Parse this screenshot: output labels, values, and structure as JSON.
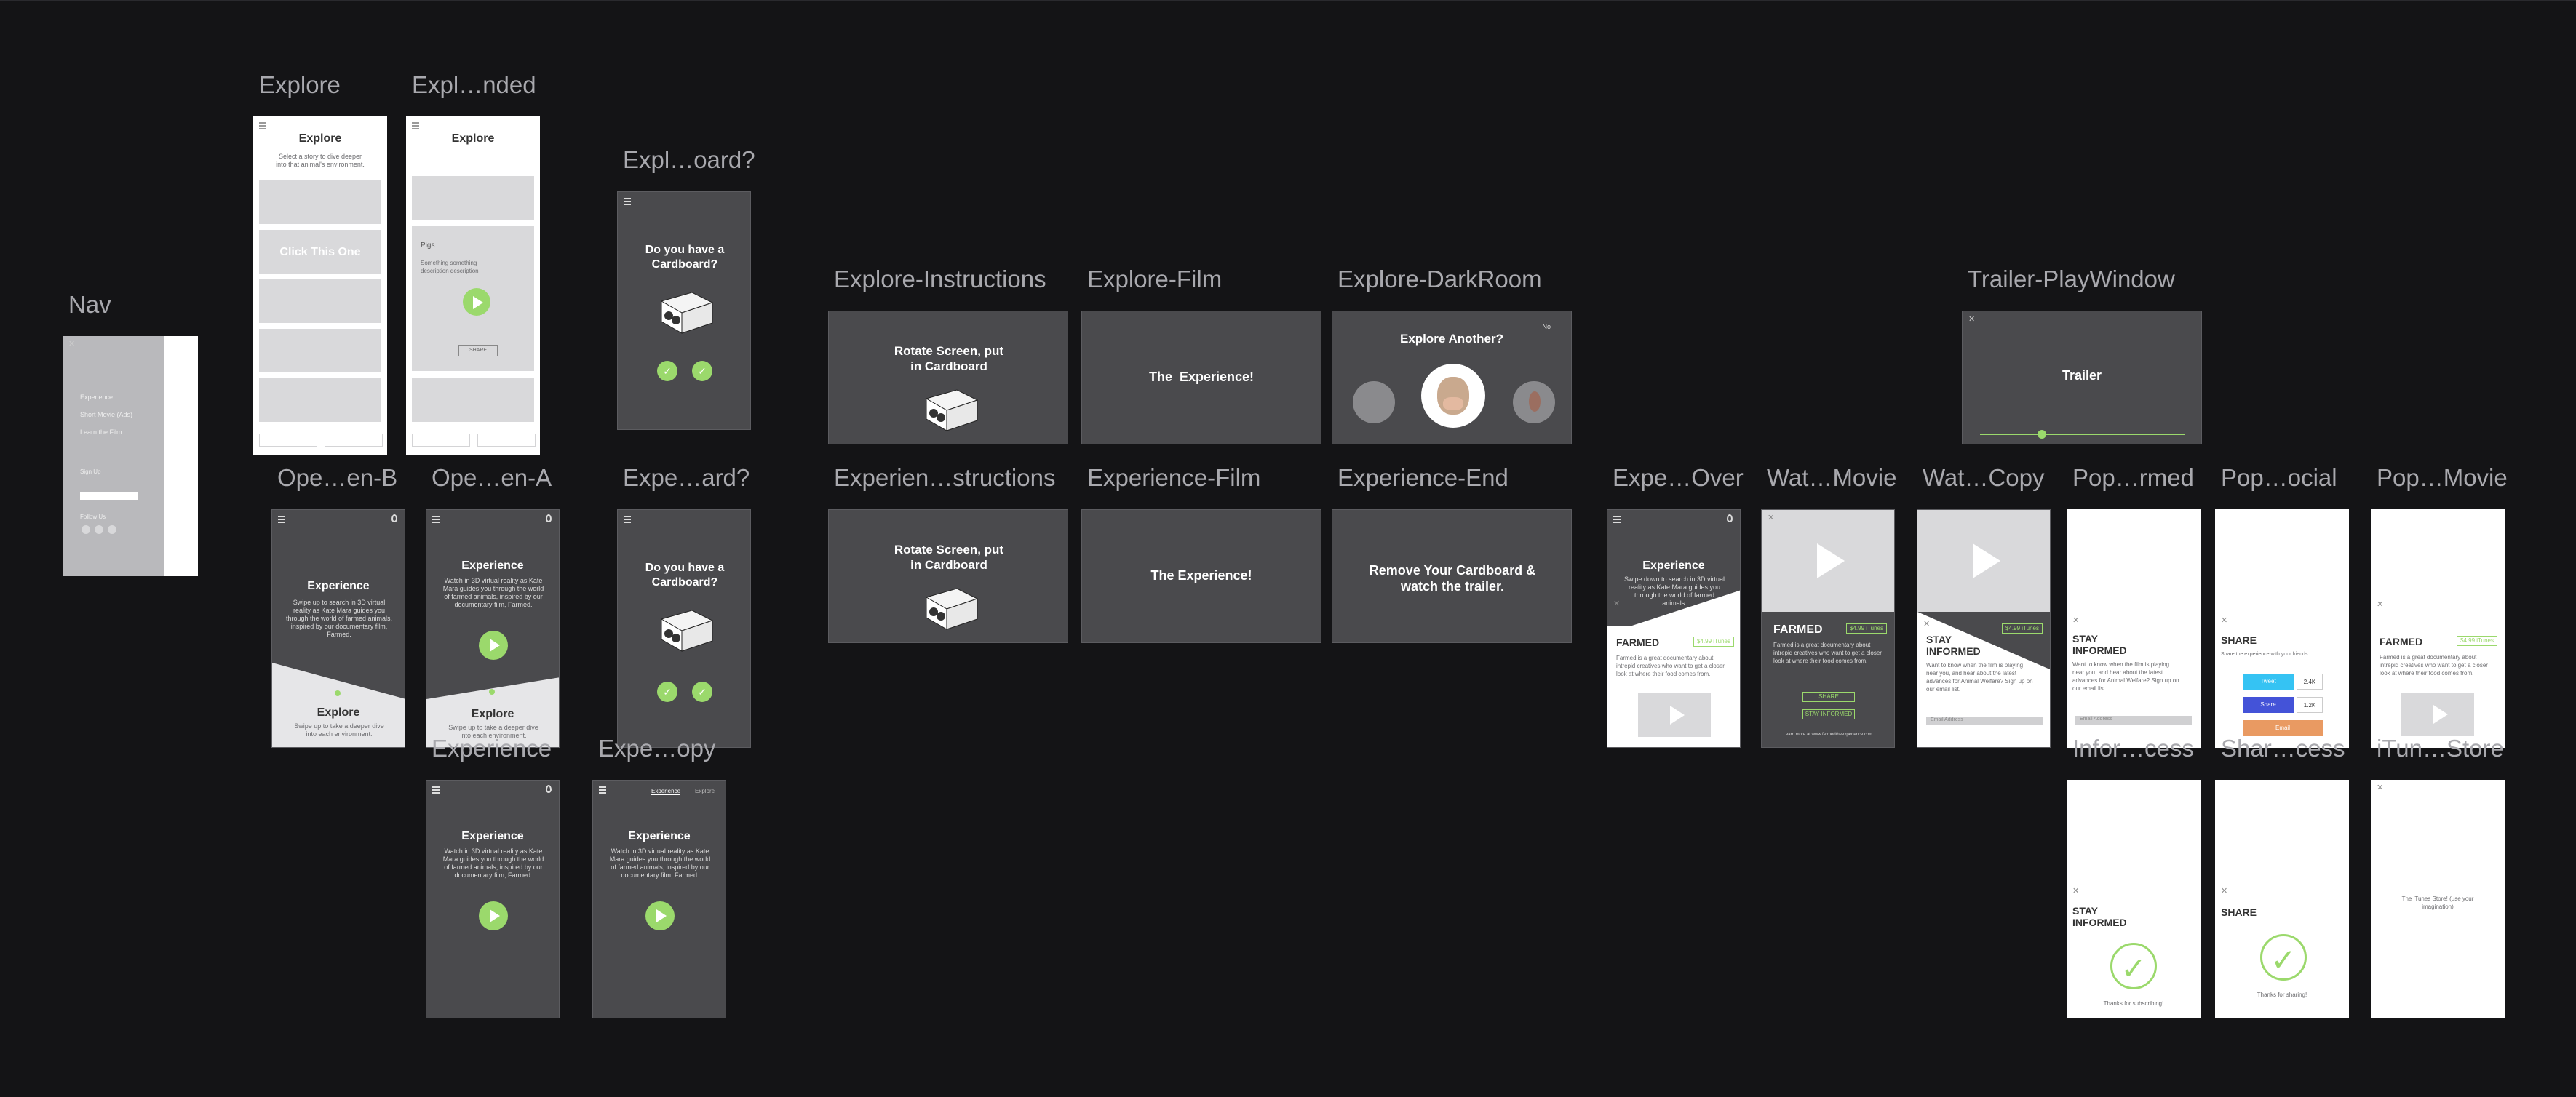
{
  "artboards": {
    "nav": {
      "label": "Nav",
      "menu_items": [
        "Experience",
        "Short Movie (Ads)",
        "Learn the Film"
      ],
      "signup_label": "Sign Up",
      "follow_label": "Follow Us"
    },
    "explore": {
      "label": "Explore",
      "title": "Explore",
      "subtitle": "Select a story to dive deeper into that animal's environment.",
      "cta": "Click This One"
    },
    "explore_expanded": {
      "label": "Expl…nded",
      "title": "Explore",
      "card_title": "Pigs",
      "card_desc": "Something something description description",
      "share": "SHARE"
    },
    "explore_cardboard": {
      "label": "Expl…oard?",
      "question": "Do you have a Cardboard?"
    },
    "explore_instructions": {
      "label": "Explore-Instructions",
      "text": "Rotate Screen, put in Cardboard"
    },
    "explore_film": {
      "label": "Explore-Film",
      "text": "The  Experience!"
    },
    "explore_darkroom": {
      "label": "Explore-DarkRoom",
      "title": "Explore Another?",
      "corner": "No"
    },
    "trailer_playwindow": {
      "label": "Trailer-PlayWindow",
      "title": "Trailer",
      "progress": 0.3
    },
    "open_b": {
      "label": "Ope…en-B",
      "title": "Experience",
      "body": "Swipe up to search in 3D virtual reality as Kate Mara guides you through the world of farmed animals, inspired by our documentary film, Farmed.",
      "bottom_title": "Explore",
      "bottom_body": "Swipe up to take a deeper dive into each environment."
    },
    "open_a": {
      "label": "Ope…en-A",
      "title": "Experience",
      "body": "Watch in 3D virtual reality as Kate Mara guides you through the world of farmed animals, inspired by our documentary film, Farmed.",
      "bottom_title": "Explore",
      "bottom_body": "Swipe up to take a deeper dive into each environment."
    },
    "experience_cardboard": {
      "label": "Expe…ard?",
      "question": "Do you have a Cardboard?"
    },
    "experience_instructions": {
      "label": "Experien…structions",
      "text": "Rotate Screen, put in Cardboard"
    },
    "experience_film": {
      "label": "Experience-Film",
      "text": "The Experience!"
    },
    "experience_end": {
      "label": "Experience-End",
      "text": "Remove Your Cardboard & watch the trailer."
    },
    "experience_over": {
      "label": "Expe…Over",
      "title": "Experience",
      "body": "Swipe down to search in 3D virtual reality as Kate Mara guides you through the world of farmed animals.",
      "farmed_title": "FARMED",
      "farmed_tag": "$4.99 iTunes",
      "farmed_body": "Farmed is a great documentary about intrepid creatives who want to get a closer look at where their food comes from."
    },
    "watch_movie": {
      "label": "Wat…Movie",
      "farmed_title": "FARMED",
      "farmed_tag": "$4.99 iTunes",
      "farmed_body": "Farmed is a great documentary about intrepid creatives who want to get a closer look at where their food comes from.",
      "share": "SHARE",
      "stay": "STAY INFORMED",
      "footer": "Learn more at www.farmedtheexperience.com"
    },
    "watch_copy": {
      "label": "Wat…Copy",
      "title": "STAY INFORMED",
      "tag": "$4.99 iTunes",
      "body": "Want to know when the film is playing near you, and hear about the latest advances for Animal Welfare? Sign up on our email list.",
      "placeholder": "Email Address"
    },
    "pop_informed": {
      "label": "Pop…rmed",
      "title": "STAY INFORMED",
      "body": "Want to know when the film is playing near you, and hear about the latest advances for Animal Welfare? Sign up on our email list.",
      "placeholder": "Email Address"
    },
    "pop_social": {
      "label": "Pop…ocial",
      "title": "SHARE",
      "body": "Share the experience with your friends.",
      "tweet": "Tweet",
      "tweet_count": "2.4K",
      "share": "Share",
      "share_count": "1.2K",
      "email": "Email"
    },
    "pop_movie": {
      "label": "Pop…Movie",
      "title": "FARMED",
      "tag": "$4.99 iTunes",
      "body": "Farmed is a great documentary about intrepid creatives who want to get a closer look at where their food comes from."
    },
    "experience": {
      "label": "Experience",
      "title": "Experience",
      "body": "Watch in 3D virtual reality as Kate Mara guides you through the world of farmed animals, inspired by our documentary film, Farmed."
    },
    "experience_copy": {
      "label": "Expe…opy",
      "tab1": "Experience",
      "tab2": "Explore",
      "title": "Experience",
      "body": "Watch in 3D virtual reality as Kate Mara guides you through the world of farmed animals, inspired by our documentary film, Farmed."
    },
    "informed_success": {
      "label": "Infor…cess",
      "title": "STAY INFORMED",
      "thanks": "Thanks for subscribing!"
    },
    "share_success": {
      "label": "Shar…cess",
      "title": "SHARE",
      "thanks": "Thanks for sharing!"
    },
    "itunes_store": {
      "label": "iTun…Store",
      "text": "The iTunes Store! (use your imagination)"
    }
  },
  "colors": {
    "canvas": "#141416",
    "screen_dark": "#4a4a4d",
    "accent_green": "#9bd96c",
    "twitter": "#35c3f3",
    "facebook": "#4453d8",
    "email": "#e99a62"
  }
}
